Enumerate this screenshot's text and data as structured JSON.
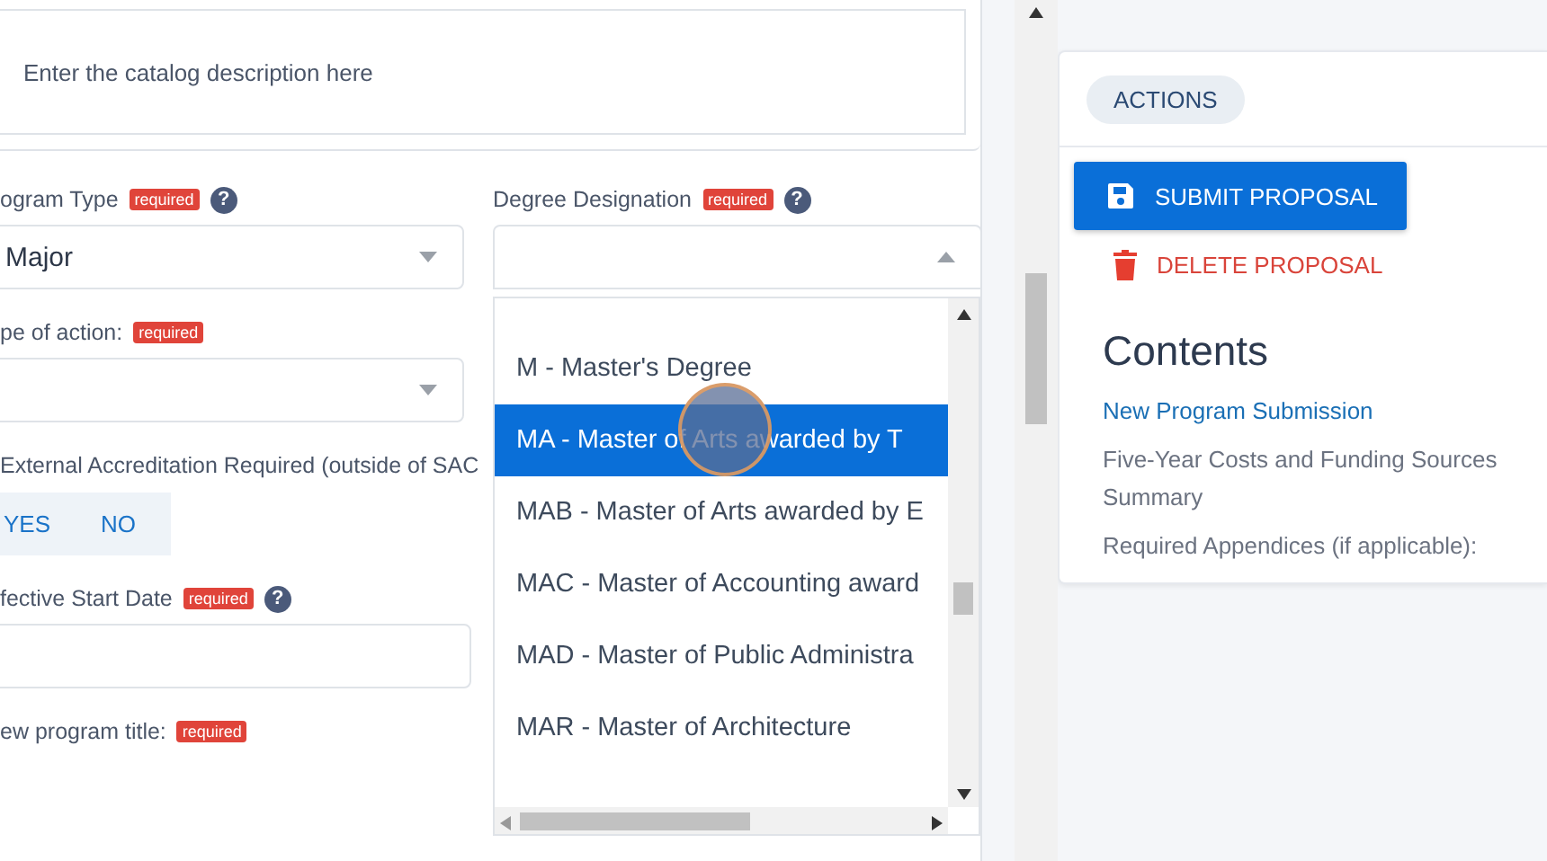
{
  "description_field": {
    "placeholder": "Enter the catalog description here"
  },
  "fields": [
    {
      "kind": "select",
      "label": "ogram Type",
      "badge": "required",
      "help": "?",
      "value": "Major"
    },
    {
      "kind": "select",
      "label": "pe of action:",
      "badge": "required"
    },
    {
      "kind": "toggle",
      "label": "External Accreditation Required (outside of SAC",
      "options": [
        "YES",
        "NO"
      ]
    },
    {
      "kind": "input",
      "label": "fective Start Date",
      "badge": "required",
      "help": "?"
    },
    {
      "kind": "label",
      "label": "ew program title:",
      "badge": "required"
    }
  ],
  "degree": {
    "label": "Degree Designation",
    "badge": "required",
    "help": "?",
    "options": [
      {
        "label": "M - Master's Degree",
        "selected": false
      },
      {
        "label": "MA - Master of Arts awarded by T",
        "selected": true
      },
      {
        "label": "MAB - Master of Arts awarded by E",
        "selected": false
      },
      {
        "label": "MAC - Master of Accounting award",
        "selected": false
      },
      {
        "label": "MAD - Master of Public Administra",
        "selected": false
      },
      {
        "label": "MAR - Master of Architecture",
        "selected": false
      }
    ]
  },
  "actions": {
    "tab": "ACTIONS",
    "buttons": [
      {
        "kind": "primary",
        "label": "SUBMIT PROPOSAL"
      },
      {
        "kind": "danger",
        "label": "DELETE PROPOSAL"
      }
    ]
  },
  "contents": {
    "title": "Contents",
    "links": [
      {
        "label": "New Program Submission",
        "selected": true
      },
      {
        "label": "Five-Year Costs and Funding Sources Summary",
        "selected": false
      },
      {
        "label": "Required Appendices (if applicable):",
        "selected": false
      }
    ]
  }
}
